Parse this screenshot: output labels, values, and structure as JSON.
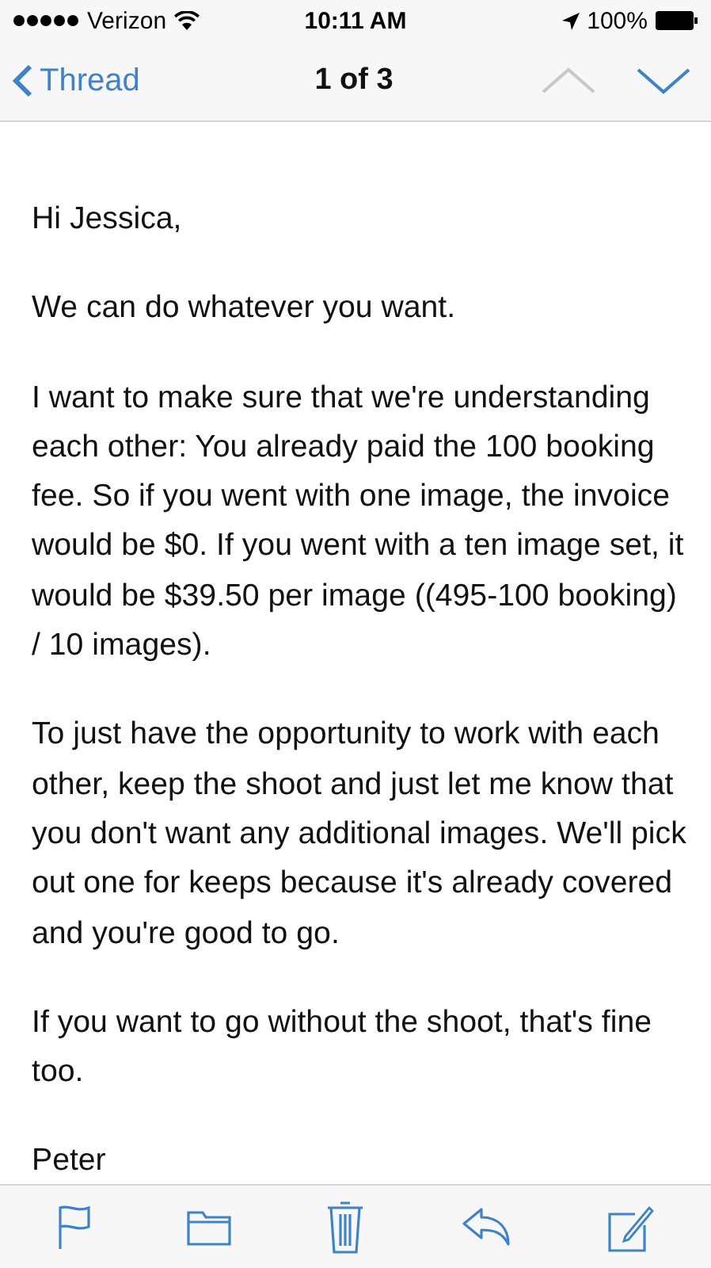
{
  "status_bar": {
    "carrier": "Verizon",
    "time": "10:11 AM",
    "battery": "100%"
  },
  "nav": {
    "back": "Thread",
    "title": "1 of 3",
    "previous": {
      "disabled": true
    },
    "next": {
      "disabled": false
    }
  },
  "message": {
    "paragraphs": [
      "Hi Jessica,",
      "We can do whatever you want.",
      "I want to make sure that we're understanding each other: You already paid the 100 booking fee. So if you went with one image, the invoice would be $0. If you went with a ten image set, it would be $39.50 per image ((495-100 booking) / 10 images).",
      "To just have the opportunity to work with each other, keep the shoot and just let me know that you don't want any additional images. We'll pick out one for keeps because it's already covered and you're good to go.",
      "If you want to go without the shoot, that's fine too.",
      "Peter"
    ]
  }
}
